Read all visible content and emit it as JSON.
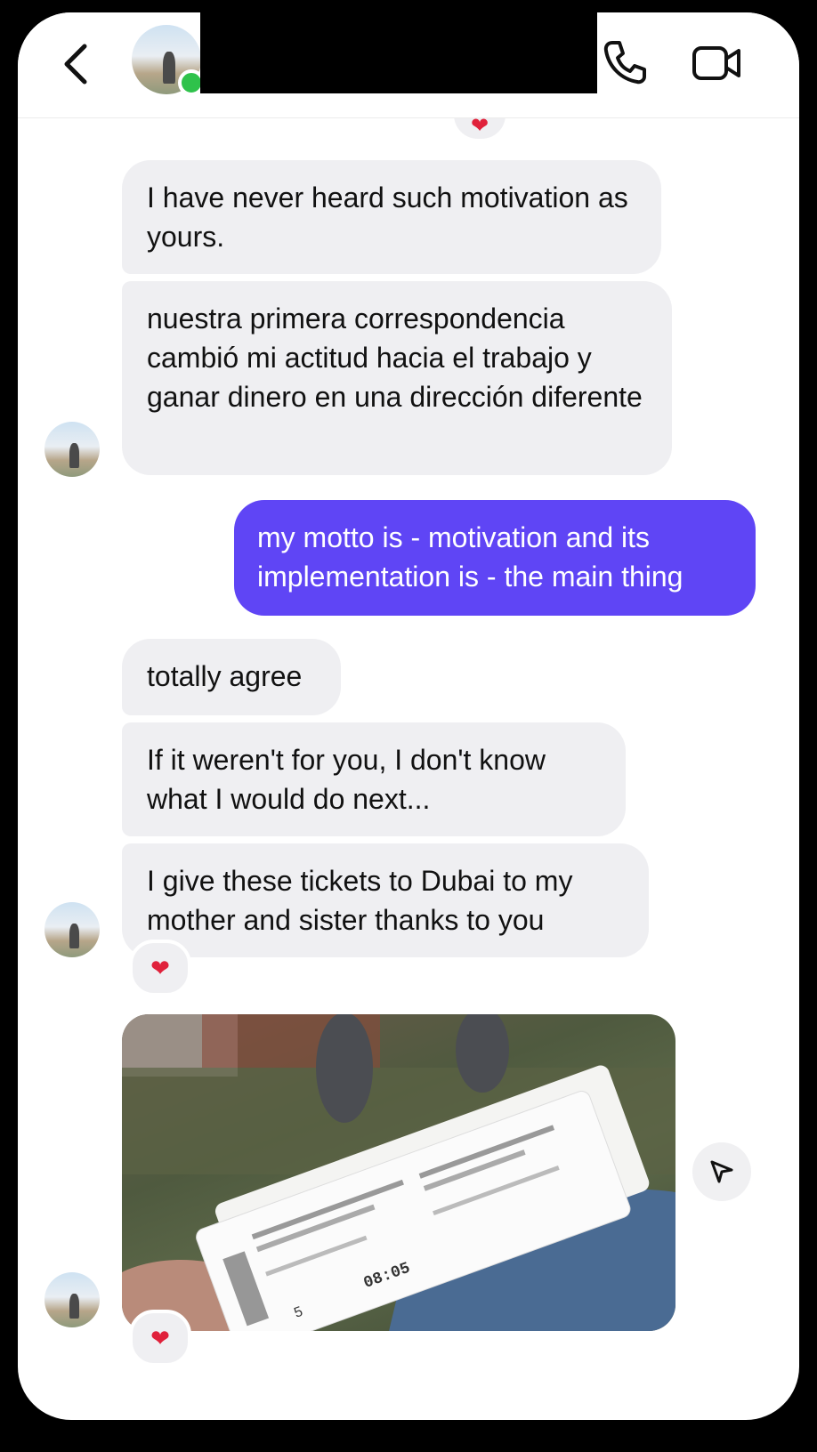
{
  "header": {
    "back_icon": "chevron-left-icon",
    "call_icon": "phone-icon",
    "video_icon": "video-camera-icon"
  },
  "reactions": {
    "heart": "❤"
  },
  "messages": [
    {
      "direction": "incoming",
      "text": "I have never heard such motivation as yours."
    },
    {
      "direction": "incoming",
      "text": "nuestra primera correspondencia cambió mi actitud hacia el trabajo y ganar dinero en una dirección diferente"
    },
    {
      "direction": "outgoing",
      "text": "my motto is - motivation and its implementation is - the main thing"
    },
    {
      "direction": "incoming",
      "text": "totally agree"
    },
    {
      "direction": "incoming",
      "text": "If it weren't for you, I don't know what I would do next..."
    },
    {
      "direction": "incoming",
      "text": "I give these tickets to Dubai to my mother and sister thanks to you"
    }
  ],
  "photo": {
    "ticket_time": "08:05",
    "ticket_gate": "5"
  },
  "colors": {
    "outgoing_bubble": "#5f45f5",
    "incoming_bubble": "#efeff2",
    "online": "#2fc24b",
    "heart": "#e0213b"
  }
}
